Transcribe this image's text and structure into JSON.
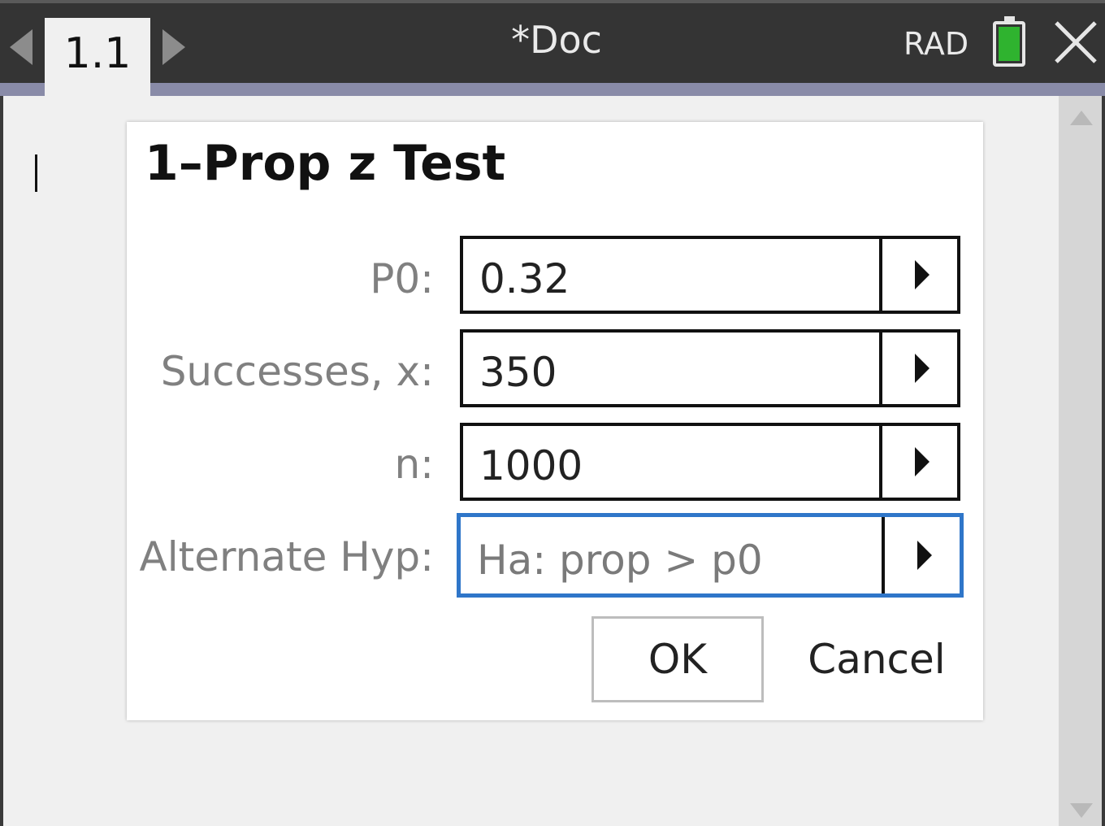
{
  "topbar": {
    "tab_label": "1.1",
    "doc_title": "*Doc",
    "angle_mode": "RAD",
    "battery_color": "#2fb32f"
  },
  "dialog": {
    "title": "1–Prop z Test",
    "fields": [
      {
        "label": "P0:",
        "value": "0.32"
      },
      {
        "label": "Successes, x:",
        "value": "350"
      },
      {
        "label": "n:",
        "value": "1000"
      },
      {
        "label": "Alternate Hyp:",
        "value": "Ha: prop > p0"
      }
    ],
    "ok_label": "OK",
    "cancel_label": "Cancel",
    "focus_color": "#2f76c9"
  }
}
